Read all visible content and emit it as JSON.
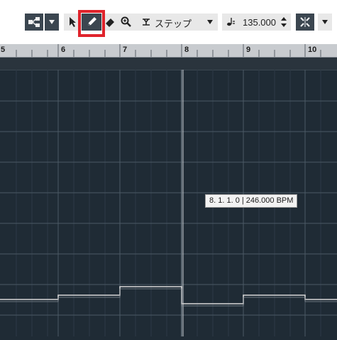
{
  "toolbar": {
    "snap_mode": "ステップ",
    "tempo_value": "135.000"
  },
  "ruler": {
    "bars": [
      "5",
      "6",
      "7",
      "8",
      "9",
      "10"
    ]
  },
  "tooltip": {
    "text": "8. 1. 1.   0 | 246.000 BPM"
  },
  "colors": {
    "highlight": "#e0242c",
    "background": "#1f2b35",
    "tempo_line": "#d8d8d8"
  },
  "icons": [
    "arrange-tool-icon",
    "select-arrow-icon",
    "pencil-icon",
    "eraser-icon",
    "zoom-icon",
    "snap-icon",
    "quarter-note-icon",
    "snap-toggle-icon"
  ]
}
